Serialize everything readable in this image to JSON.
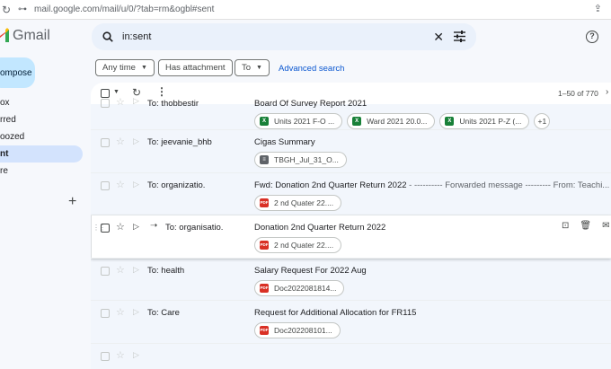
{
  "browser": {
    "url": "mail.google.com/mail/u/0/?tab=rm&ogbl#sent"
  },
  "app": {
    "title": "Gmail",
    "compose_label": "ompose"
  },
  "nav": {
    "items": [
      {
        "label": "ox"
      },
      {
        "label": "rred"
      },
      {
        "label": "oozed"
      },
      {
        "label": "nt"
      },
      {
        "label": "re"
      }
    ]
  },
  "search": {
    "query": "in:sent"
  },
  "filters": {
    "any_time": "Any time",
    "has_attachment": "Has attachment",
    "to": "To",
    "advanced": "Advanced search"
  },
  "toolbar": {
    "count": "1–50 of 770"
  },
  "emails": [
    {
      "sender": "To: thobbestir",
      "subject": "Board Of Survey Report 2021",
      "snippet": "",
      "attachments": [
        {
          "type": "xls",
          "name": "Units 2021 F-O ..."
        },
        {
          "type": "xls",
          "name": "Ward 2021 20.0..."
        },
        {
          "type": "xls",
          "name": "Units 2021 P-Z (..."
        }
      ],
      "more": "+1"
    },
    {
      "sender": "To: jeevanie_bhb",
      "subject": "Cigas Summary",
      "snippet": "",
      "attachments": [
        {
          "type": "doc",
          "name": "TBGH_Jul_31_O..."
        }
      ]
    },
    {
      "sender": "To: organizatio.",
      "subject": "Fwd: Donation 2nd Quarter Return 2022",
      "snippet": " - ---------- Forwarded message --------- From: Teachi...",
      "attachments": [
        {
          "type": "pdf",
          "name": "2 nd Quater 22...."
        }
      ]
    },
    {
      "sender": "To: organisatio.",
      "subject": "Donation 2nd Quarter Return 2022",
      "snippet": "",
      "attachments": [
        {
          "type": "pdf",
          "name": "2 nd Quater 22...."
        }
      ]
    },
    {
      "sender": "To: health",
      "subject": "Salary Request For 2022 Aug",
      "snippet": "",
      "attachments": [
        {
          "type": "pdf",
          "name": "Doc2022081814..."
        }
      ]
    },
    {
      "sender": "To: Care",
      "subject": "Request for Additional Allocation for FR115",
      "snippet": "",
      "attachments": [
        {
          "type": "pdf",
          "name": "Doc202208101..."
        }
      ]
    }
  ],
  "icons": {
    "xls_glyph": "X",
    "pdf_glyph": "PDF",
    "doc_glyph": "≡"
  },
  "colors": {
    "accent": "#0b57d0",
    "compose_bg": "#c2e7ff",
    "active_nav": "#d3e3fd",
    "search_bg": "#eaf1fb",
    "xls": "#188038",
    "pdf": "#d93025"
  }
}
